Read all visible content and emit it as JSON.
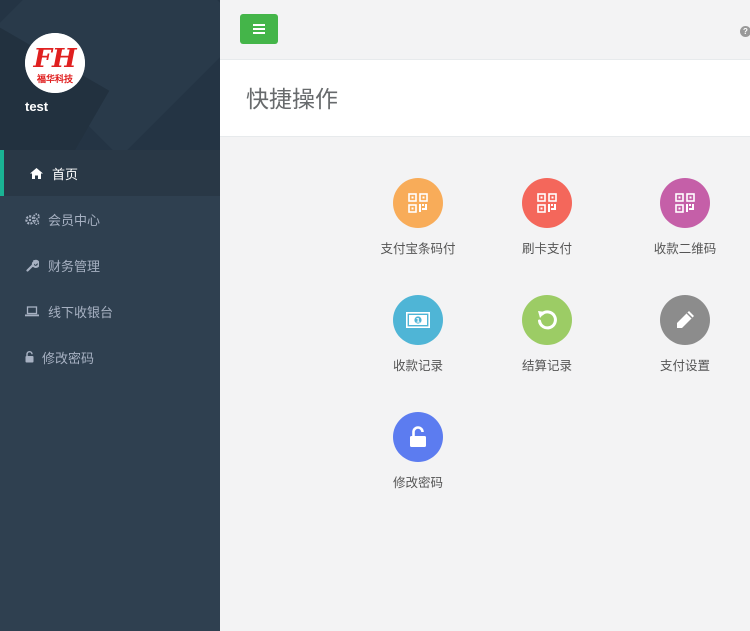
{
  "user": {
    "name": "test",
    "logo_text": "福华科技",
    "logo_initials": "FH"
  },
  "sidebar": {
    "items": [
      {
        "label": "首页",
        "icon": "home-icon",
        "active": true
      },
      {
        "label": "会员中心",
        "icon": "gears-icon",
        "active": false
      },
      {
        "label": "财务管理",
        "icon": "wrench-icon",
        "active": false
      },
      {
        "label": "线下收银台",
        "icon": "laptop-icon",
        "active": false
      },
      {
        "label": "修改密码",
        "icon": "unlock-icon",
        "active": false
      }
    ]
  },
  "header": {
    "title": "快捷操作"
  },
  "topbar": {
    "menu_icon": "bars-icon",
    "help_icon": "question-icon"
  },
  "quick_actions": [
    {
      "label": "支付宝条码付",
      "icon": "qrcode-icon",
      "color": "#f8ac59"
    },
    {
      "label": "刷卡支付",
      "icon": "qrcode-icon",
      "color": "#f4675b"
    },
    {
      "label": "收款二维码",
      "icon": "qrcode-icon",
      "color": "#c55fa8"
    },
    {
      "label": "收款记录",
      "icon": "money-icon",
      "color": "#4fb5d6"
    },
    {
      "label": "结算记录",
      "icon": "refresh-icon",
      "color": "#9ccc65"
    },
    {
      "label": "支付设置",
      "icon": "pencil-icon",
      "color": "#8c8c8c"
    },
    {
      "label": "修改密码",
      "icon": "unlock-icon",
      "color": "#5c7cf0"
    }
  ],
  "colors": {
    "sidebar": "#2f4050",
    "accent": "#1ab394",
    "menu_button": "#44b549"
  }
}
